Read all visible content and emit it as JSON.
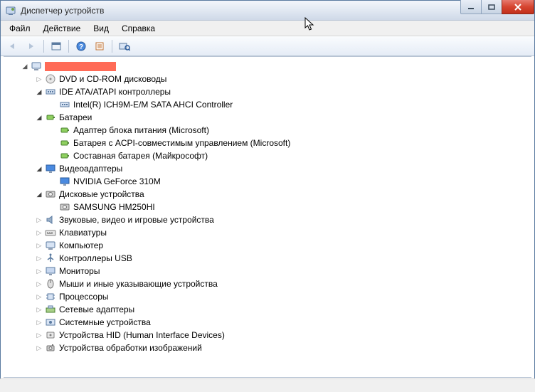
{
  "window": {
    "title": "Диспетчер устройств"
  },
  "menu": {
    "file": "Файл",
    "action": "Действие",
    "view": "Вид",
    "help": "Справка"
  },
  "tree": {
    "root_redacted": true,
    "categories": [
      {
        "label": "DVD и CD-ROM дисководы",
        "expanded": false,
        "icon": "optical"
      },
      {
        "label": "IDE ATA/ATAPI контроллеры",
        "expanded": true,
        "icon": "ide",
        "children": [
          {
            "label": "Intel(R) ICH9M-E/M SATA AHCI Controller",
            "icon": "ide"
          }
        ]
      },
      {
        "label": "Батареи",
        "expanded": true,
        "icon": "battery",
        "children": [
          {
            "label": "Адаптер блока питания (Microsoft)",
            "icon": "battery"
          },
          {
            "label": "Батарея с ACPI-совместимым управлением (Microsoft)",
            "icon": "battery"
          },
          {
            "label": "Составная батарея (Майкрософт)",
            "icon": "battery"
          }
        ]
      },
      {
        "label": "Видеоадаптеры",
        "expanded": true,
        "icon": "display",
        "children": [
          {
            "label": "NVIDIA GeForce 310M",
            "icon": "display"
          }
        ]
      },
      {
        "label": "Дисковые устройства",
        "expanded": true,
        "icon": "disk",
        "children": [
          {
            "label": "SAMSUNG HM250HI",
            "icon": "disk"
          }
        ]
      },
      {
        "label": "Звуковые, видео и игровые устройства",
        "expanded": false,
        "icon": "sound"
      },
      {
        "label": "Клавиатуры",
        "expanded": false,
        "icon": "keyboard"
      },
      {
        "label": "Компьютер",
        "expanded": false,
        "icon": "computer"
      },
      {
        "label": "Контроллеры USB",
        "expanded": false,
        "icon": "usb"
      },
      {
        "label": "Мониторы",
        "expanded": false,
        "icon": "monitor"
      },
      {
        "label": "Мыши и иные указывающие устройства",
        "expanded": false,
        "icon": "mouse"
      },
      {
        "label": "Процессоры",
        "expanded": false,
        "icon": "cpu"
      },
      {
        "label": "Сетевые адаптеры",
        "expanded": false,
        "icon": "network"
      },
      {
        "label": "Системные устройства",
        "expanded": false,
        "icon": "system"
      },
      {
        "label": "Устройства HID (Human Interface Devices)",
        "expanded": false,
        "icon": "hid"
      },
      {
        "label": "Устройства обработки изображений",
        "expanded": false,
        "icon": "imaging"
      }
    ]
  }
}
